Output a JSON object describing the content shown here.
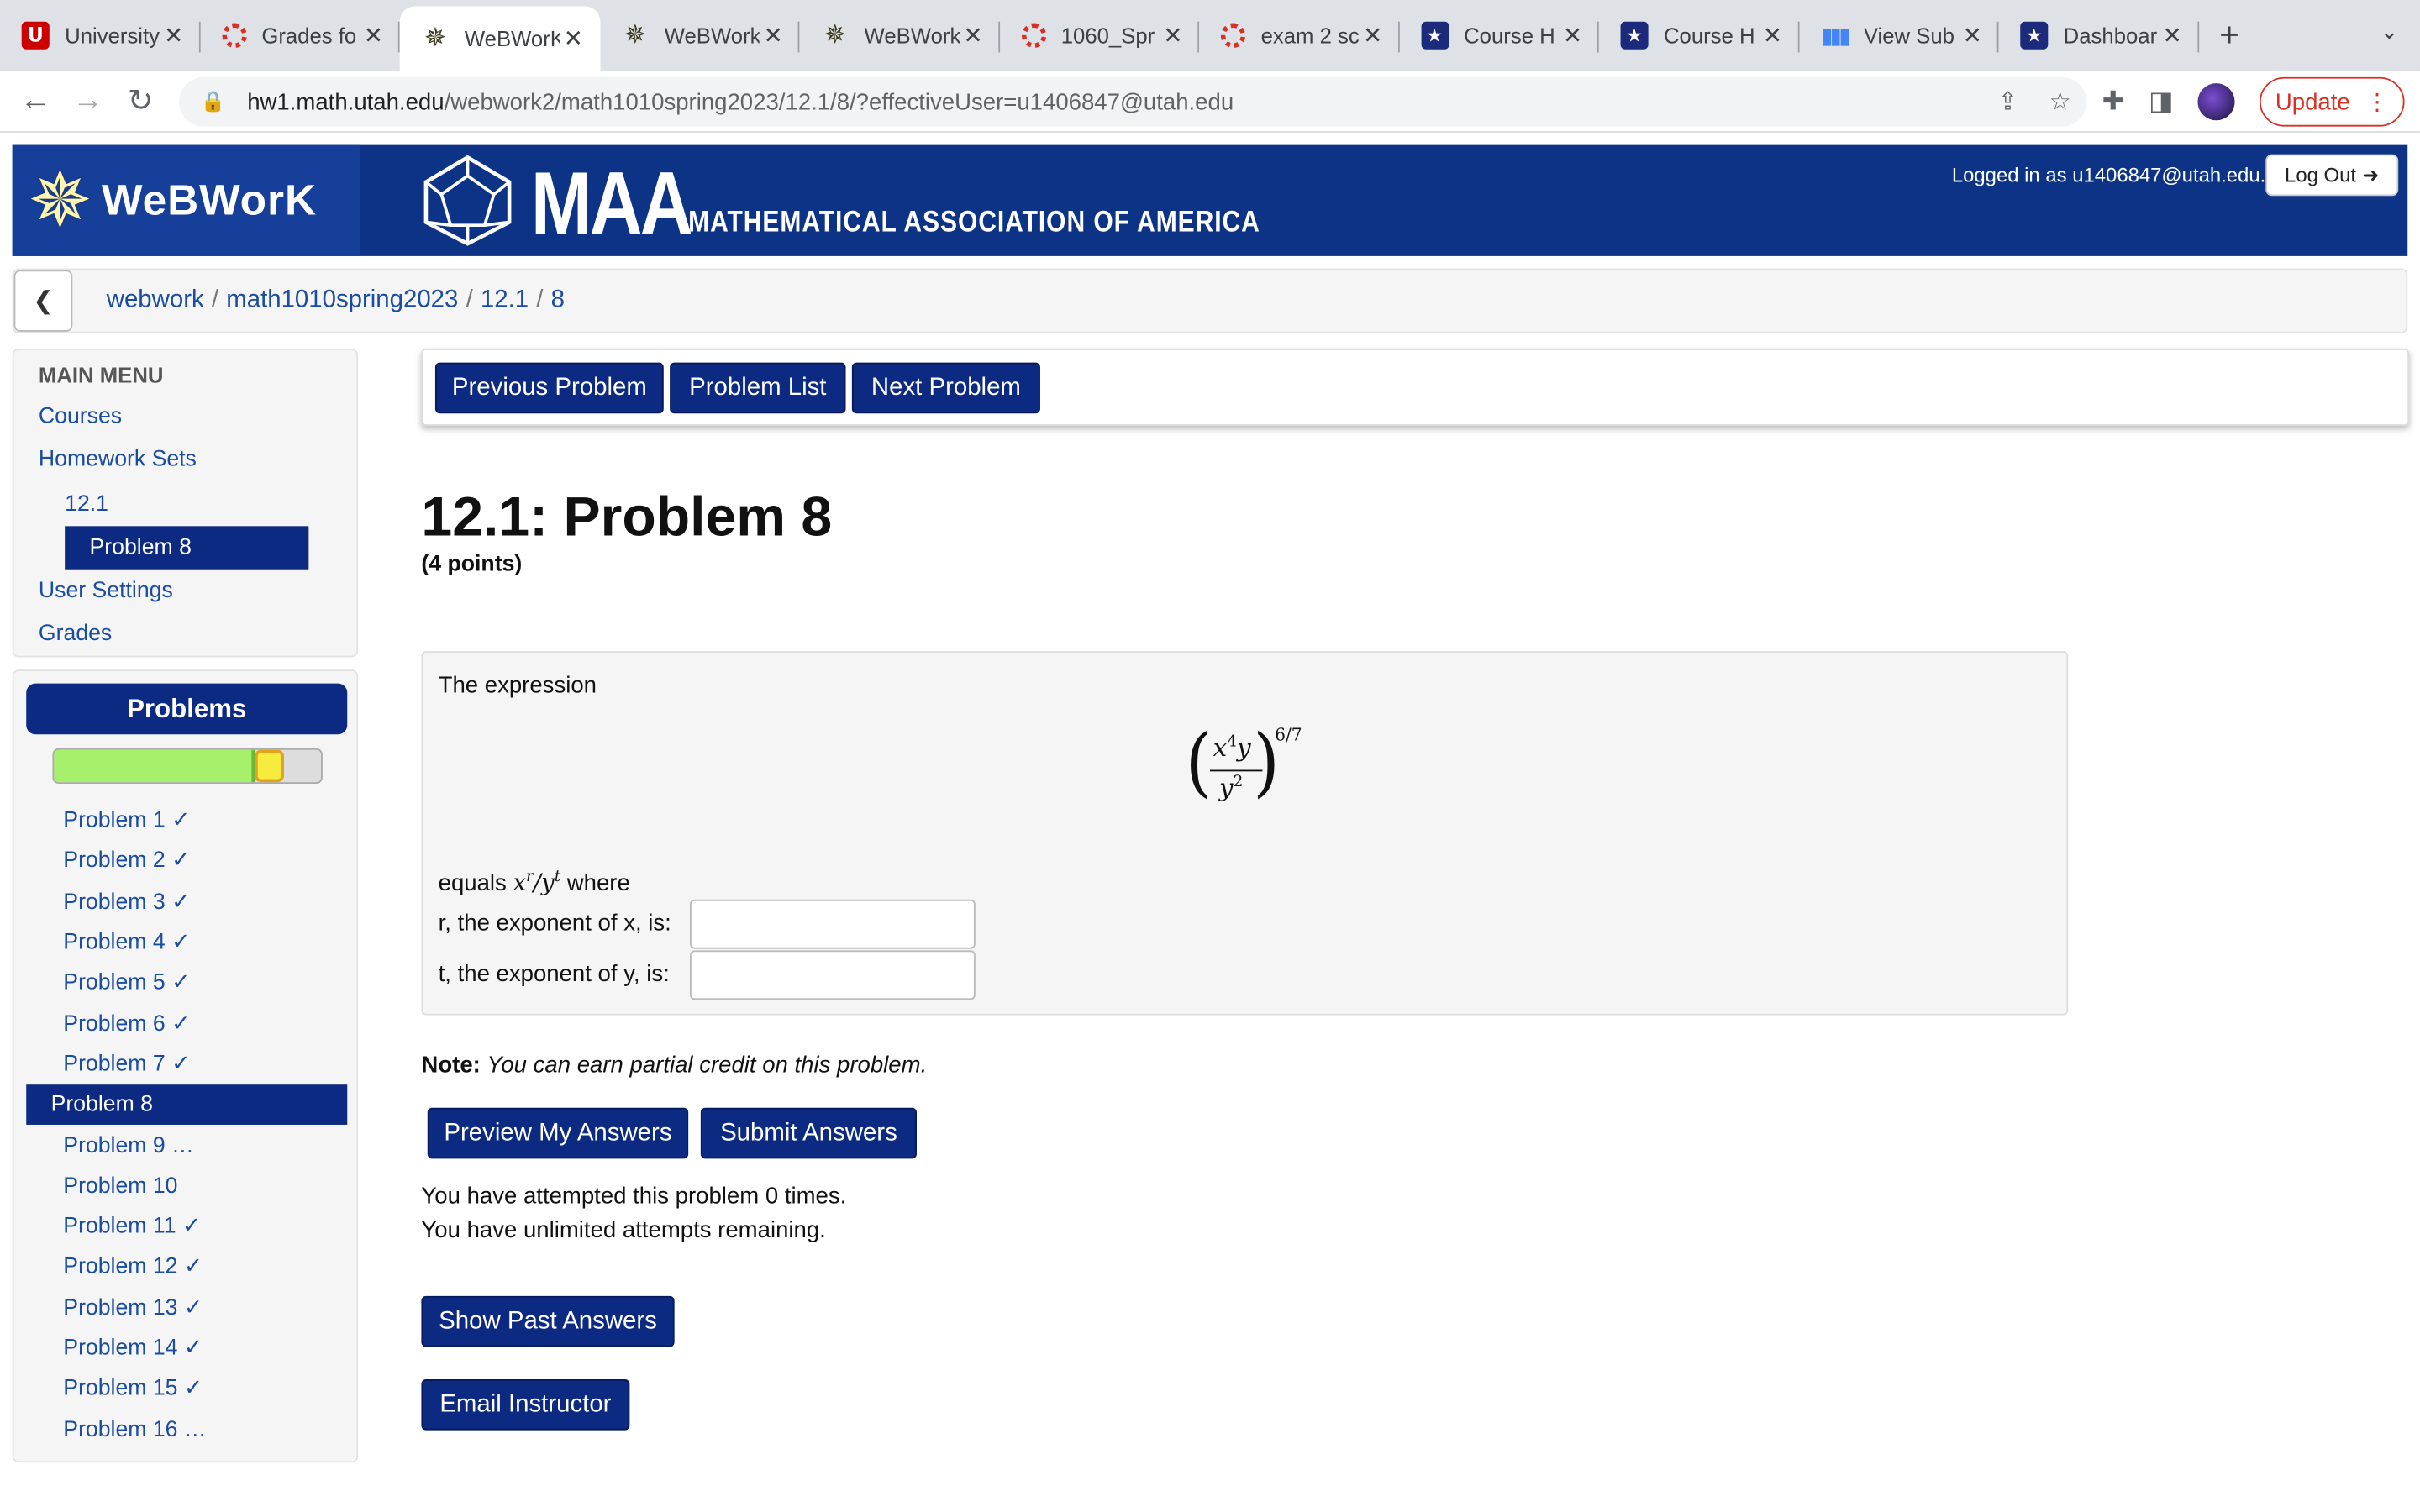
{
  "browser": {
    "tabs": [
      {
        "title": "University",
        "icon": "utah-u-icon"
      },
      {
        "title": "Grades fo",
        "icon": "canvas-icon"
      },
      {
        "title": "WeBWorK",
        "icon": "webwork-star-icon",
        "active": true
      },
      {
        "title": "WeBWork",
        "icon": "webwork-star-icon"
      },
      {
        "title": "WeBWork",
        "icon": "webwork-star-icon"
      },
      {
        "title": "1060_Spr",
        "icon": "canvas-icon"
      },
      {
        "title": "exam 2 sc",
        "icon": "canvas-icon"
      },
      {
        "title": "Course H",
        "icon": "shield-icon"
      },
      {
        "title": "Course H",
        "icon": "shield-icon"
      },
      {
        "title": "View Sub",
        "icon": "bar-chart-icon"
      },
      {
        "title": "Dashboar",
        "icon": "shield-icon"
      }
    ],
    "url_host": "hw1.math.utah.edu",
    "url_path": "/webwork2/math1010spring2023/12.1/8/?effectiveUser=u1406847@utah.edu",
    "update_label": "Update"
  },
  "banner": {
    "logo_text": "WeBWorK",
    "maa_short": "MAA",
    "maa_full": "MATHEMATICAL ASSOCIATION OF AMERICA",
    "logged_in": "Logged in as u1406847@utah.edu.",
    "logout_label": "Log Out"
  },
  "breadcrumb": {
    "items": [
      "webwork",
      "math1010spring2023",
      "12.1",
      "8"
    ]
  },
  "main_menu": {
    "header": "MAIN MENU",
    "courses": "Courses",
    "homework_sets": "Homework Sets",
    "set": "12.1",
    "problem": "Problem 8",
    "user_settings": "User Settings",
    "grades": "Grades"
  },
  "problems_panel": {
    "header": "Problems",
    "progress": {
      "correct_fraction": 0.75,
      "current_fraction": 0.11
    },
    "items": [
      "Problem 1 ✓",
      "Problem 2 ✓",
      "Problem 3 ✓",
      "Problem 4 ✓",
      "Problem 5 ✓",
      "Problem 6 ✓",
      "Problem 7 ✓",
      "Problem 8",
      "Problem 9 …",
      "Problem 10",
      "Problem 11 ✓",
      "Problem 12 ✓",
      "Problem 13 ✓",
      "Problem 14 ✓",
      "Problem 15 ✓",
      "Problem 16 …"
    ],
    "active_index": 7
  },
  "nav_buttons": {
    "previous": "Previous Problem",
    "list": "Problem List",
    "next": "Next Problem"
  },
  "problem": {
    "title": "12.1: Problem 8",
    "points": "(4 points)",
    "intro": "The expression",
    "numerator_base": "x",
    "numerator_exp": "4",
    "numerator_y": "y",
    "denominator_base": "y",
    "denominator_exp": "2",
    "outer_exp": "6/7",
    "equals_prefix": "equals ",
    "equals_expr_x": "x",
    "equals_expr_r": "r",
    "equals_expr_slash": "/",
    "equals_expr_y": "y",
    "equals_expr_t": "t",
    "equals_suffix": " where",
    "r_label": "r, the exponent of x, is:",
    "t_label": "t, the exponent of y, is:",
    "r_value": "",
    "t_value": ""
  },
  "note": {
    "bold": "Note:",
    "text": "You can earn partial credit on this problem."
  },
  "actions": {
    "preview": "Preview My Answers",
    "submit": "Submit Answers",
    "attempts": "You have attempted this problem 0 times.",
    "remaining": "You have unlimited attempts remaining.",
    "past_answers": "Show Past Answers",
    "email": "Email Instructor"
  }
}
